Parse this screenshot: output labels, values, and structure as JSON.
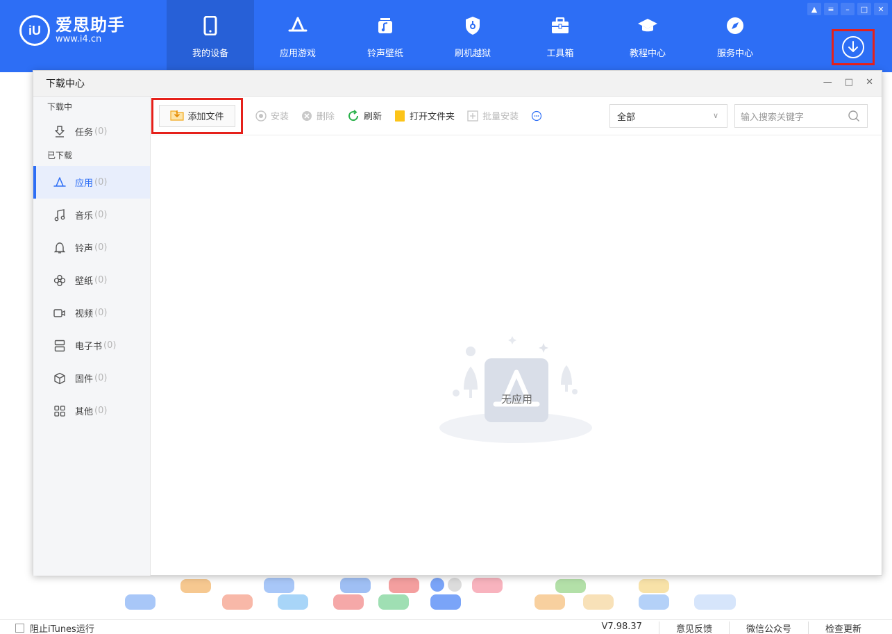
{
  "app": {
    "name": "爱思助手",
    "url": "www.i4.cn",
    "badge": "iU"
  },
  "nav": [
    {
      "label": "我的设备",
      "icon": "phone-icon",
      "active": true
    },
    {
      "label": "应用游戏",
      "icon": "app-store-icon",
      "active": false
    },
    {
      "label": "铃声壁纸",
      "icon": "music-note-icon",
      "active": false
    },
    {
      "label": "刷机越狱",
      "icon": "shield-key-icon",
      "active": false
    },
    {
      "label": "工具箱",
      "icon": "toolbox-icon",
      "active": false
    },
    {
      "label": "教程中心",
      "icon": "graduation-cap-icon",
      "active": false
    },
    {
      "label": "服务中心",
      "icon": "compass-icon",
      "active": false
    }
  ],
  "window_controls": [
    "shirt-icon",
    "menu-icon",
    "minimize-icon",
    "maximize-icon",
    "close-icon"
  ],
  "download_center": {
    "title": "下载中心",
    "sidebar": {
      "section_downloading": "下载中",
      "task_label": "任务",
      "task_count": "(0)",
      "section_downloaded": "已下载",
      "items": [
        {
          "label": "应用",
          "count": "(0)",
          "icon": "app-store-icon",
          "active": true
        },
        {
          "label": "音乐",
          "count": "(0)",
          "icon": "music-note-icon",
          "active": false
        },
        {
          "label": "铃声",
          "count": "(0)",
          "icon": "bell-icon",
          "active": false
        },
        {
          "label": "壁纸",
          "count": "(0)",
          "icon": "flower-icon",
          "active": false
        },
        {
          "label": "视频",
          "count": "(0)",
          "icon": "video-icon",
          "active": false
        },
        {
          "label": "电子书",
          "count": "(0)",
          "icon": "ebook-icon",
          "active": false
        },
        {
          "label": "固件",
          "count": "(0)",
          "icon": "cube-icon",
          "active": false
        },
        {
          "label": "其他",
          "count": "(0)",
          "icon": "grid-icon",
          "active": false
        }
      ]
    },
    "toolbar": {
      "add_file": "添加文件",
      "install": "安装",
      "delete": "删除",
      "refresh": "刷新",
      "open_folder": "打开文件夹",
      "batch_install": "批量安装",
      "filter_value": "全部",
      "search_placeholder": "输入搜索关键字"
    },
    "empty_text": "无应用"
  },
  "statusbar": {
    "left": "阻止iTunes运行",
    "version": "V7.98.37",
    "feedback": "意见反馈",
    "wechat": "微信公众号",
    "update": "检查更新"
  },
  "colors": {
    "brand_blue": "#2d6ef5",
    "highlight_red": "#e5201a"
  }
}
